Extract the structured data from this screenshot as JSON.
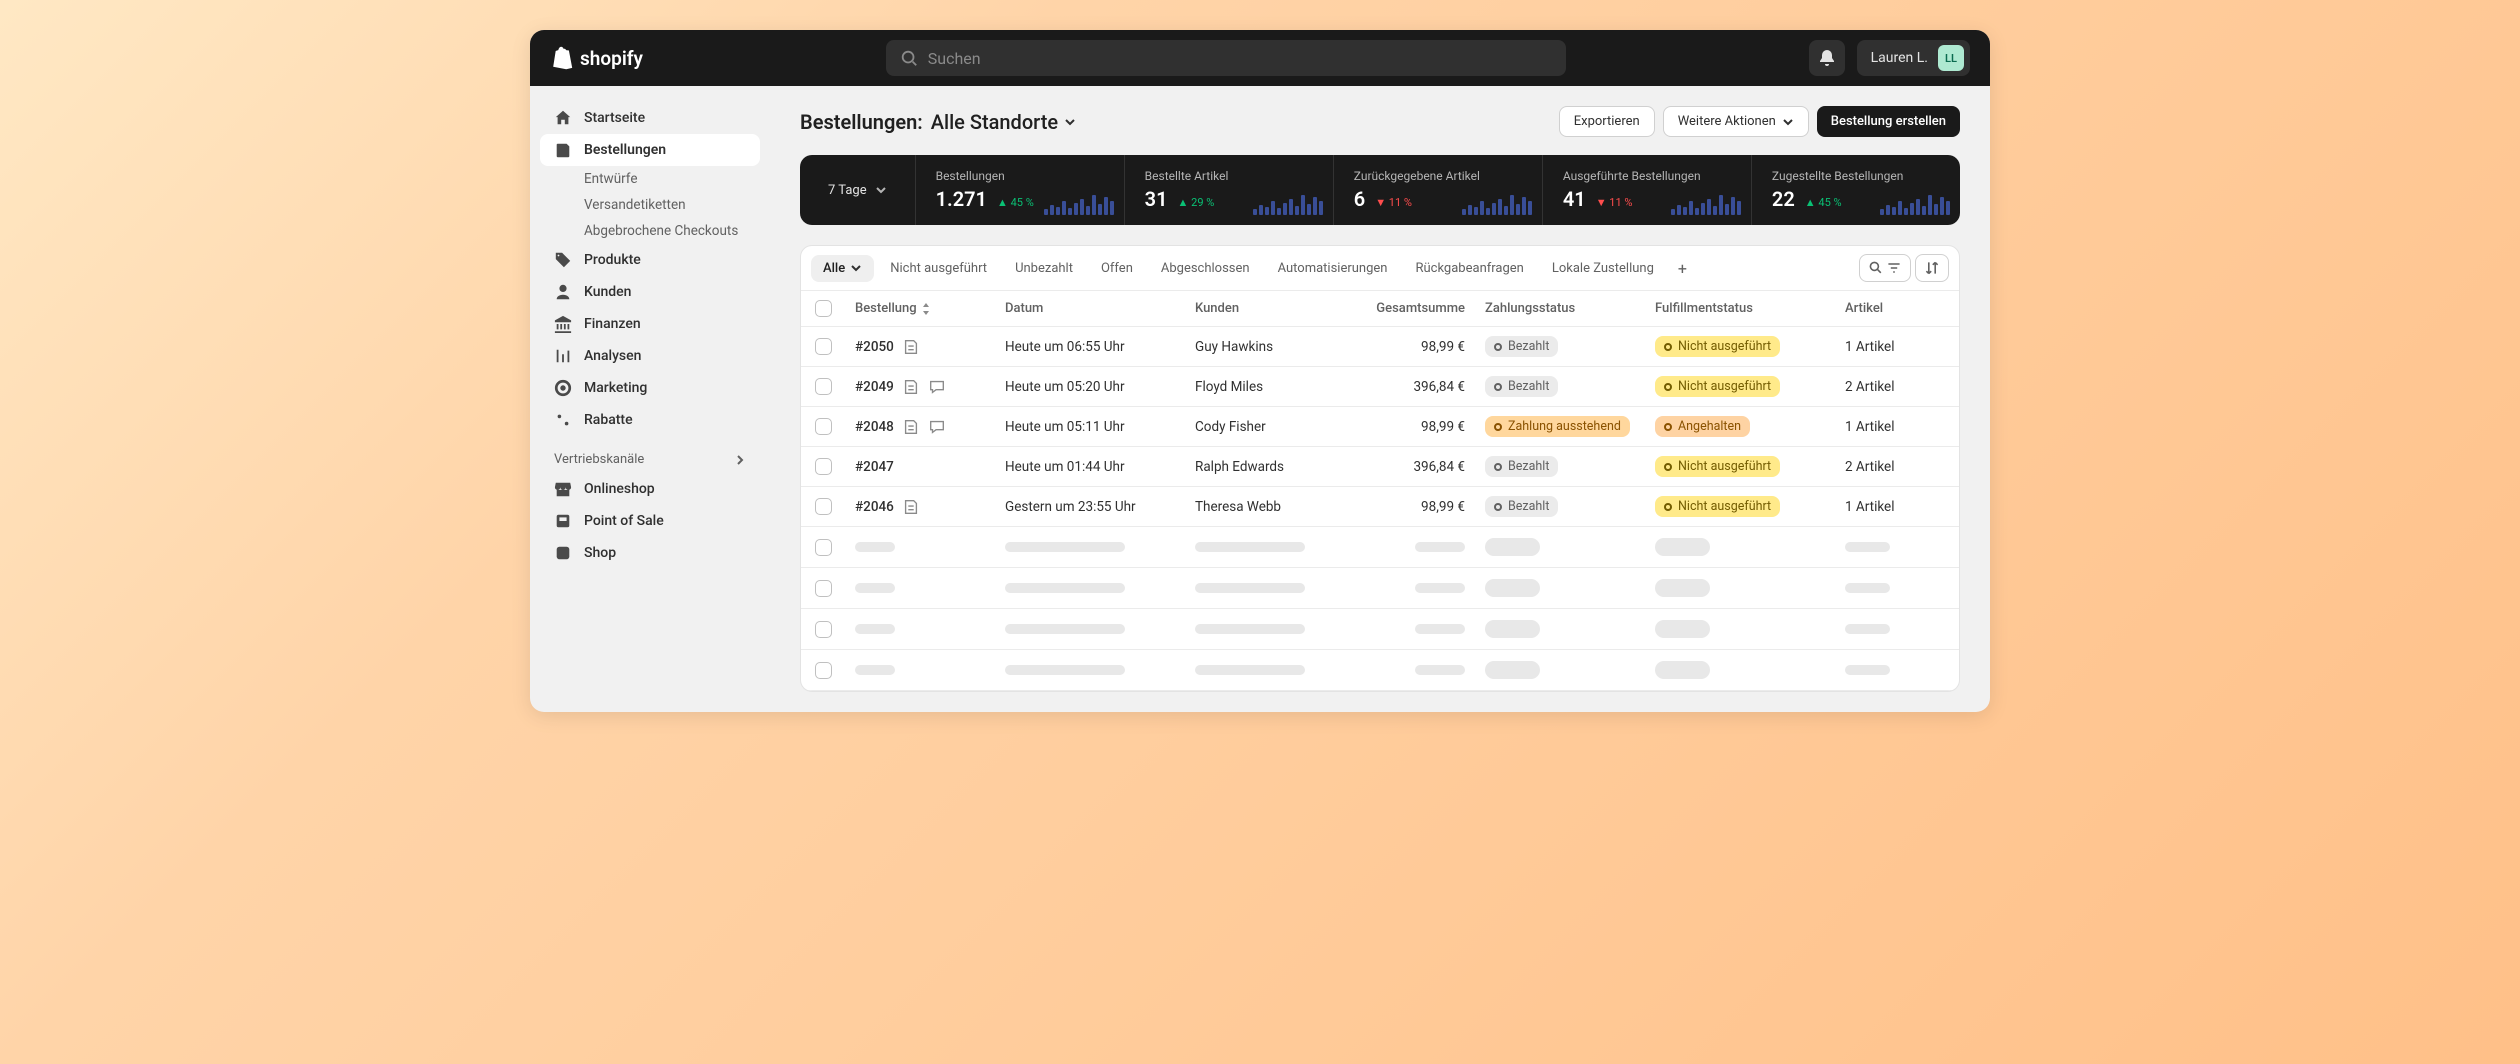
{
  "brand": "shopify",
  "search_placeholder": "Suchen",
  "user": {
    "name": "Lauren L.",
    "initials": "LL"
  },
  "nav": {
    "home": "Startseite",
    "orders": "Bestellungen",
    "drafts": "Entwürfe",
    "labels": "Versandetiketten",
    "abandoned": "Abgebrochene Checkouts",
    "products": "Produkte",
    "customers": "Kunden",
    "finances": "Finanzen",
    "analytics": "Analysen",
    "marketing": "Marketing",
    "discounts": "Rabatte",
    "channels_header": "Vertriebskanäle",
    "onlinestore": "Onlineshop",
    "pos": "Point of Sale",
    "shop": "Shop"
  },
  "page": {
    "title_prefix": "Bestellungen:",
    "location": "Alle Standorte",
    "export": "Exportieren",
    "more": "Weitere Aktionen",
    "create": "Bestellung erstellen"
  },
  "stats": {
    "range": "7 Tage",
    "cards": [
      {
        "label": "Bestellungen",
        "value": "1.271",
        "delta": "45 %",
        "dir": "up"
      },
      {
        "label": "Bestellte Artikel",
        "value": "31",
        "delta": "29 %",
        "dir": "up"
      },
      {
        "label": "Zurückgegebene Artikel",
        "value": "6",
        "delta": "11 %",
        "dir": "down"
      },
      {
        "label": "Ausgeführte Bestellungen",
        "value": "41",
        "delta": "11 %",
        "dir": "down"
      },
      {
        "label": "Zugestellte Bestellungen",
        "value": "22",
        "delta": "45 %",
        "dir": "up"
      }
    ]
  },
  "tabs": [
    "Alle",
    "Nicht ausgeführt",
    "Unbezahlt",
    "Offen",
    "Abgeschlossen",
    "Automatisierungen",
    "Rückgabeanfragen",
    "Lokale Zustellung"
  ],
  "columns": {
    "order": "Bestellung",
    "date": "Datum",
    "customer": "Kunden",
    "total": "Gesamtsumme",
    "payment": "Zahlungsstatus",
    "fulfillment": "Fulfillmentstatus",
    "items": "Artikel"
  },
  "badges": {
    "paid": "Bezahlt",
    "payment_pending": "Zahlung ausstehend",
    "unfulfilled": "Nicht ausgeführt",
    "onhold": "Angehalten"
  },
  "rows": [
    {
      "id": "#2050",
      "icons": [
        "note"
      ],
      "date": "Heute um 06:55 Uhr",
      "customer": "Guy Hawkins",
      "total": "98,99 €",
      "payment": "paid",
      "fulfillment": "unfulfilled",
      "items": "1 Artikel"
    },
    {
      "id": "#2049",
      "icons": [
        "note",
        "chat"
      ],
      "date": "Heute um 05:20 Uhr",
      "customer": "Floyd Miles",
      "total": "396,84 €",
      "payment": "paid",
      "fulfillment": "unfulfilled",
      "items": "2 Artikel"
    },
    {
      "id": "#2048",
      "icons": [
        "note",
        "chat"
      ],
      "date": "Heute um 05:11 Uhr",
      "customer": "Cody Fisher",
      "total": "98,99 €",
      "payment": "pending",
      "fulfillment": "onhold",
      "items": "1 Artikel"
    },
    {
      "id": "#2047",
      "icons": [],
      "date": "Heute um 01:44 Uhr",
      "customer": "Ralph Edwards",
      "total": "396,84 €",
      "payment": "paid",
      "fulfillment": "unfulfilled",
      "items": "2 Artikel"
    },
    {
      "id": "#2046",
      "icons": [
        "note"
      ],
      "date": "Gestern um 23:55 Uhr",
      "customer": "Theresa Webb",
      "total": "98,99 €",
      "payment": "paid",
      "fulfillment": "unfulfilled",
      "items": "1 Artikel"
    }
  ]
}
